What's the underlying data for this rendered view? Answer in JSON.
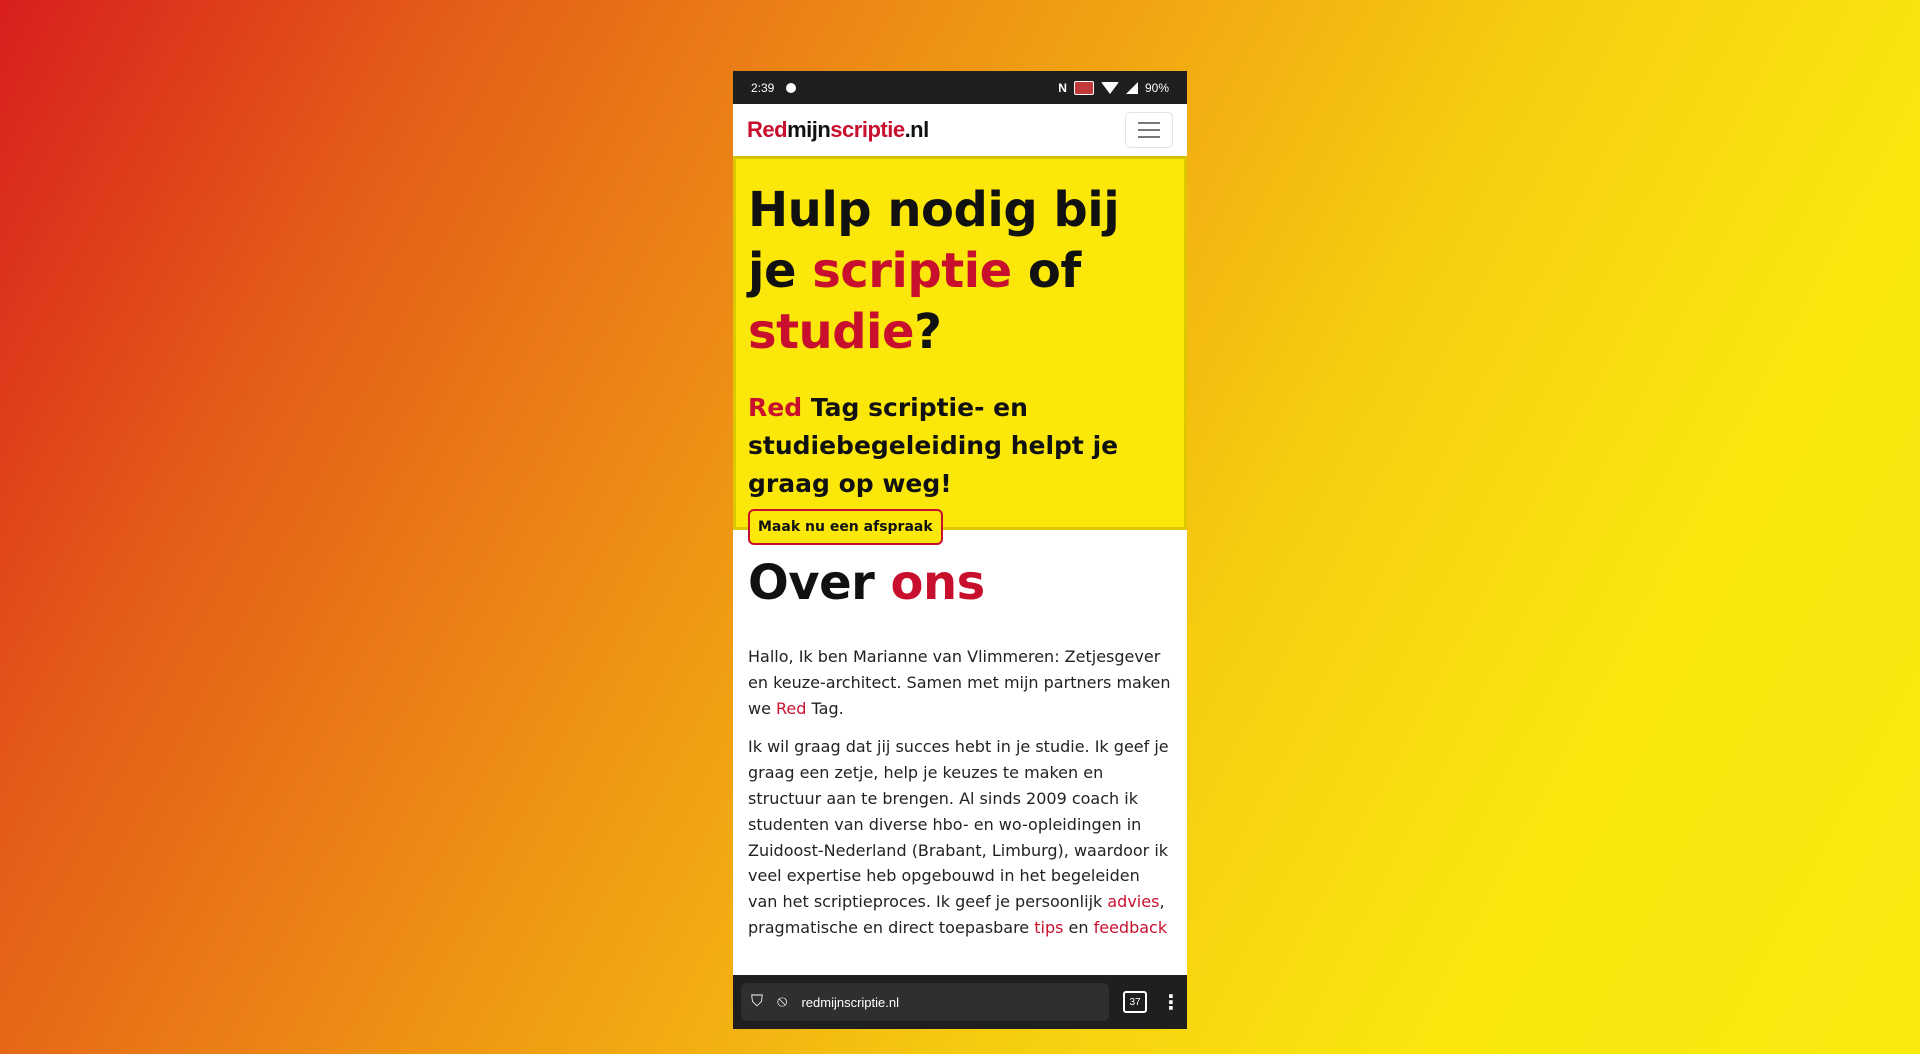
{
  "status_bar": {
    "time": "2:39",
    "battery": "90%"
  },
  "header": {
    "logo_red": "Red",
    "logo_mid": "mijn",
    "logo_red2": "scriptie",
    "logo_end": ".nl"
  },
  "hero": {
    "title_1": "Hulp nodig bij je ",
    "title_accent_1": "scriptie",
    "title_2": " of ",
    "title_accent_2": "studie",
    "title_3": "?",
    "subtitle_accent": "Red",
    "subtitle_rest": " Tag scriptie- en studiebegeleiding helpt je graag op weg!",
    "cta_label": "Maak nu een afspraak"
  },
  "about": {
    "heading_1": "Over ",
    "heading_accent": "ons",
    "p1_a": "Hallo, Ik ben Marianne van Vlimmeren: Zetjesgever en keuze-architect. Samen met mijn partners maken we ",
    "p1_link": "Red",
    "p1_b": " Tag.",
    "p2_a": "Ik wil graag dat jij succes hebt in je studie. Ik geef je graag een zetje, help je keuzes te maken en structuur aan te brengen. Al sinds 2009 coach ik studenten van diverse hbo- en wo-opleidingen in Zuidoost-Nederland (Brabant, Limburg), waardoor ik veel expertise heb opgebouwd in het begeleiden van het scriptieproces. Ik geef je persoonlijk ",
    "p2_link1": "advies",
    "p2_b": ", pragmatische en direct toepasbare ",
    "p2_link2": "tips",
    "p2_c": " en ",
    "p2_link3": "feedback"
  },
  "browser": {
    "url": "redmijnscriptie.nl",
    "tab_count": "37"
  },
  "colors": {
    "accent_red": "#c8102e",
    "hero_yellow": "#fbe80a"
  }
}
